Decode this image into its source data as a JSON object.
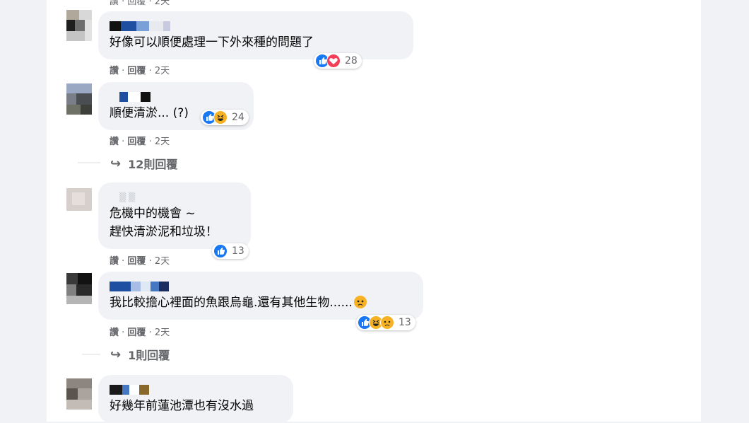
{
  "top_meta": "讚 · 回覆 · 2天",
  "comments": [
    {
      "text": [
        "好像可以順便處理一下外來種的問題了"
      ],
      "reactions": [
        "like-icon",
        "love-icon"
      ],
      "count": "28",
      "meta": {
        "like": "讚",
        "reply": "回覆",
        "time": "2天"
      }
    },
    {
      "text": [
        "順便清淤... (?)"
      ],
      "reactions": [
        "like-icon",
        "haha-icon"
      ],
      "count": "24",
      "meta": {
        "like": "讚",
        "reply": "回覆",
        "time": "2天"
      },
      "replies_label": "12則回覆"
    },
    {
      "text": [
        "危機中的機會 ~",
        "趕快清淤泥和垃圾！"
      ],
      "reactions": [
        "like-icon"
      ],
      "count": "13",
      "meta": {
        "like": "讚",
        "reply": "回覆",
        "time": "2天"
      }
    },
    {
      "text": [
        "我比較擔心裡面的魚跟烏龜.還有其他生物......"
      ],
      "trailing_emoji": "sad-face-icon",
      "reactions": [
        "like-icon",
        "haha-icon",
        "sad-icon"
      ],
      "count": "13",
      "meta": {
        "like": "讚",
        "reply": "回覆",
        "time": "2天"
      },
      "replies_label": "1則回覆"
    },
    {
      "text": [
        "好幾年前蓮池潭也有沒水過"
      ]
    }
  ],
  "colors": {
    "like": "#1877f2",
    "love": "#f33e58",
    "haha": "#f7b125",
    "meta": "#65676b",
    "bubble": "#f0f2f5"
  }
}
